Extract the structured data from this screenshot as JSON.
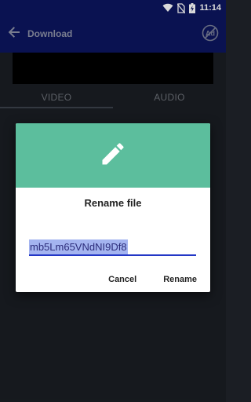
{
  "status_bar": {
    "time": "11:14",
    "icons": [
      "wifi-icon",
      "no-sim-icon",
      "battery-charging-icon"
    ]
  },
  "app_bar": {
    "title": "Download",
    "back_icon": "arrow-back-icon",
    "action_icon": "no-ads-icon"
  },
  "tabs": [
    {
      "label": "VIDEO",
      "active": true
    },
    {
      "label": "AUDIO",
      "active": false
    }
  ],
  "dialog": {
    "header_icon": "pencil-icon",
    "header_color": "#5cbe9d",
    "title": "Rename file",
    "input_value": "mb5Lm65VNdNI9Df8",
    "cancel_label": "Cancel",
    "rename_label": "Rename"
  },
  "colors": {
    "app_bar": "#0c1660",
    "background": "#1b1e24",
    "input_underline": "#2337c6",
    "selection": "#a4b4f0"
  }
}
